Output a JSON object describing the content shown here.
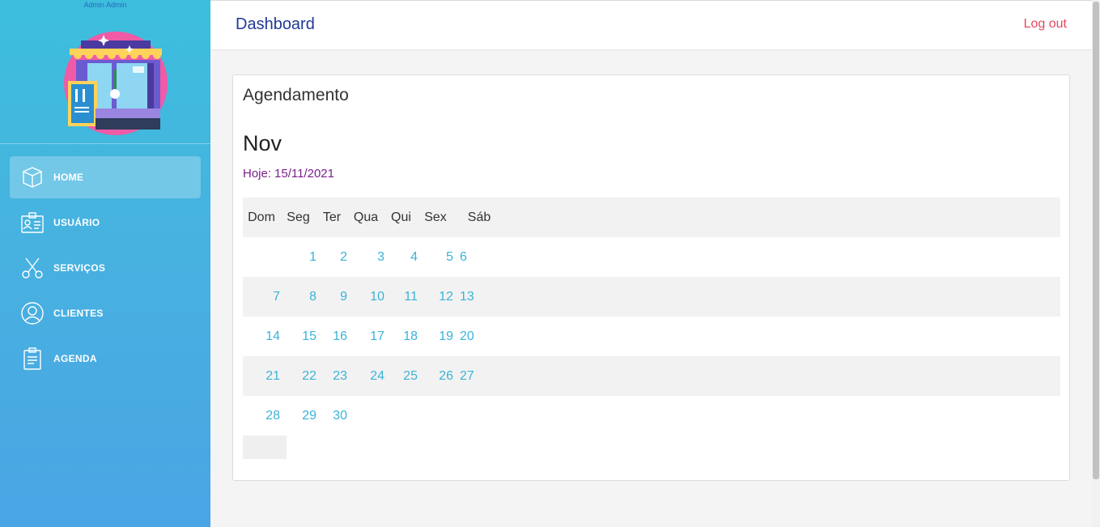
{
  "sidebar": {
    "user_name": "Admin Admin",
    "items": [
      {
        "label": "HOME",
        "icon": "cube-icon",
        "active": true
      },
      {
        "label": "USUÁRIO",
        "icon": "id-card-icon",
        "active": false
      },
      {
        "label": "SERVIÇOS",
        "icon": "scissors-icon",
        "active": false
      },
      {
        "label": "CLIENTES",
        "icon": "user-circle-icon",
        "active": false
      },
      {
        "label": "AGENDA",
        "icon": "clipboard-icon",
        "active": false
      }
    ]
  },
  "header": {
    "title": "Dashboard",
    "logout_label": "Log out"
  },
  "card": {
    "title": "Agendamento",
    "month": "Nov",
    "today_label": "Hoje:",
    "today_date": "15/11/2021",
    "weekdays": [
      "Dom",
      "Seg",
      "Ter",
      "Qua",
      "Qui",
      "Sex",
      "Sáb"
    ],
    "weeks": [
      [
        "",
        "1",
        "2",
        "3",
        "4",
        "5",
        "6"
      ],
      [
        "7",
        "8",
        "9",
        "10",
        "11",
        "12",
        "13"
      ],
      [
        "14",
        "15",
        "16",
        "17",
        "18",
        "19",
        "20"
      ],
      [
        "21",
        "22",
        "23",
        "24",
        "25",
        "26",
        "27"
      ],
      [
        "28",
        "29",
        "30",
        "",
        "",
        "",
        ""
      ]
    ]
  },
  "colors": {
    "accent": "#3bb3d8",
    "header_title": "#1f3a93",
    "logout": "#e8475b",
    "today": "#7b1f8c"
  }
}
